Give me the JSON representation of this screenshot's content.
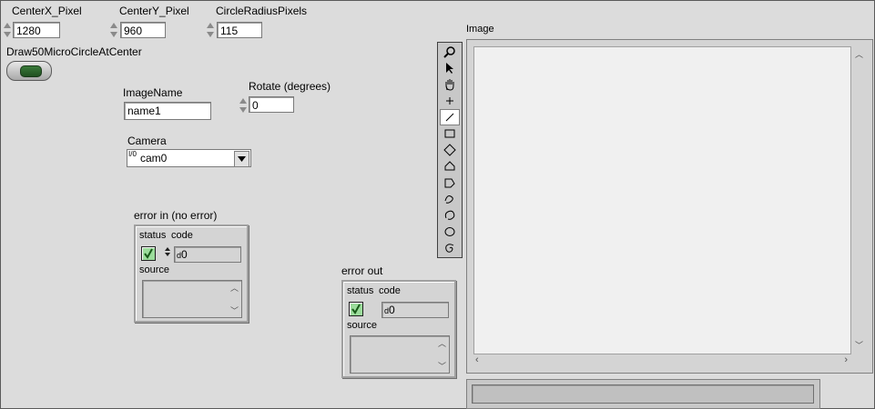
{
  "controls": {
    "center_x": {
      "label": "CenterX_Pixel",
      "value": "1280"
    },
    "center_y": {
      "label": "CenterY_Pixel",
      "value": "960"
    },
    "circle_radius": {
      "label": "CircleRadiusPixels",
      "value": "115"
    },
    "draw_button": {
      "label": "Draw50MicroCircleAtCenter"
    },
    "image_name": {
      "label": "ImageName",
      "value": "name1"
    },
    "rotate": {
      "label": "Rotate (degrees)",
      "value": "0"
    },
    "camera": {
      "label": "Camera",
      "value": "cam0",
      "io_glyph": "I/0"
    }
  },
  "error_in": {
    "label": "error in (no error)",
    "status_label": "status",
    "code_label": "code",
    "code_value": "0",
    "code_prefix": "d",
    "source_label": "source"
  },
  "error_out": {
    "label": "error out",
    "status_label": "status",
    "code_label": "code",
    "code_value": "0",
    "code_prefix": "d",
    "source_label": "source"
  },
  "image_display": {
    "label": "Image",
    "tools": [
      "zoom-icon",
      "pointer-icon",
      "pan-icon",
      "crosshair-icon",
      "line-icon",
      "rectangle-icon",
      "rotated-rectangle-icon",
      "polygon-icon",
      "freehand-polygon-icon",
      "freehand-line-icon",
      "annulus-icon",
      "oval-icon",
      "spiral-icon"
    ]
  }
}
